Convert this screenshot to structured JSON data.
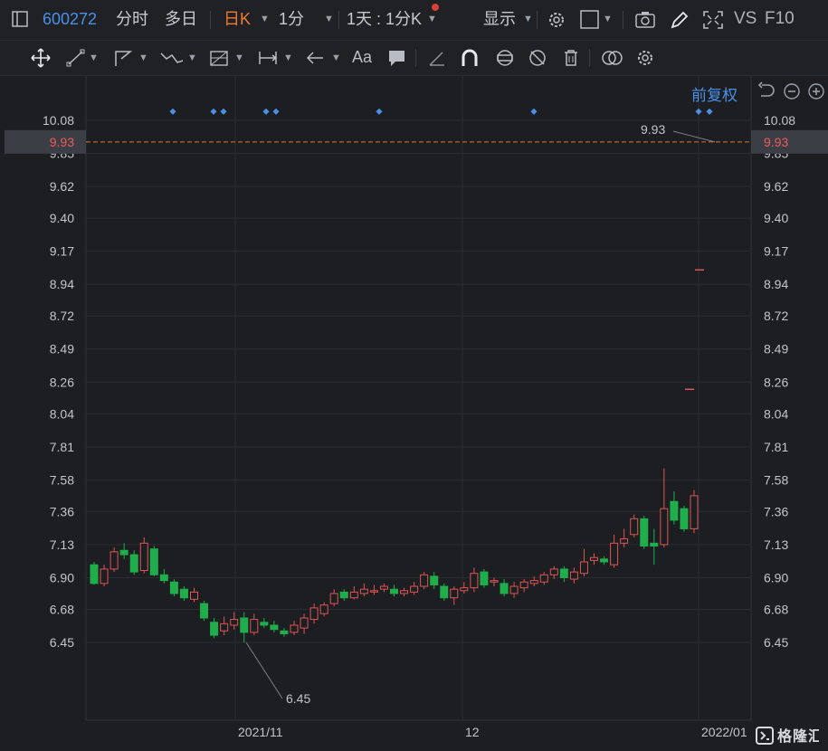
{
  "toolbar": {
    "stock_code": "600272",
    "tab_intraday": "分时",
    "tab_multiday": "多日",
    "tab_daily_k": "日K",
    "period_1min": "1分",
    "range_label": "1天 : 1分K",
    "display_label": "显示",
    "vs_label": "VS",
    "f10_label": "F10"
  },
  "chart_controls": {
    "adjust_label": "前复权"
  },
  "colors": {
    "up": "#e05454",
    "down": "#1fae4b",
    "accent": "#4b8fe8",
    "current_price": "#f05a5a",
    "dashed_line": "#e07030"
  },
  "icons": [
    "layout-icon",
    "chevron-down-icon",
    "gear-icon",
    "square-icon",
    "camera-icon",
    "pencil-icon",
    "fullscreen-icon",
    "move-icon",
    "line-tool-icon",
    "polyline-tool-icon",
    "wave-tool-icon",
    "fib-tool-icon",
    "measure-tool-icon",
    "arrow-tool-icon",
    "text-tool-icon",
    "comment-tool-icon",
    "ruler-icon",
    "magnet-icon",
    "eye-sync-icon",
    "hide-icon",
    "trash-icon",
    "overlap-icon",
    "settings-icon",
    "undo-icon",
    "zoom-out-icon",
    "zoom-in-icon"
  ],
  "chart_data": {
    "type": "candlestick",
    "y_ticks": [
      "10.08",
      "9.85",
      "9.62",
      "9.40",
      "9.17",
      "8.94",
      "8.72",
      "8.49",
      "8.26",
      "8.04",
      "7.81",
      "7.58",
      "7.36",
      "7.13",
      "6.90",
      "6.68",
      "6.45"
    ],
    "x_ticks": [
      "2021/11",
      "12",
      "2022/01"
    ],
    "current_price": "9.93",
    "current_price_annotation": "9.93",
    "low_annotation": "6.45",
    "ylim": [
      6.3,
      10.22
    ],
    "candles": [
      [
        6.99,
        6.86,
        7.01,
        6.85
      ],
      [
        6.86,
        6.96,
        6.99,
        6.84
      ],
      [
        6.96,
        7.08,
        7.11,
        6.94
      ],
      [
        7.09,
        7.06,
        7.14,
        7.03
      ],
      [
        7.06,
        6.94,
        7.09,
        6.92
      ],
      [
        6.95,
        7.14,
        7.18,
        6.93
      ],
      [
        7.1,
        6.92,
        7.12,
        6.91
      ],
      [
        6.92,
        6.88,
        6.96,
        6.86
      ],
      [
        6.87,
        6.79,
        6.89,
        6.77
      ],
      [
        6.82,
        6.76,
        6.84,
        6.74
      ],
      [
        6.75,
        6.8,
        6.83,
        6.73
      ],
      [
        6.72,
        6.62,
        6.74,
        6.6
      ],
      [
        6.59,
        6.5,
        6.62,
        6.48
      ],
      [
        6.53,
        6.58,
        6.63,
        6.5
      ],
      [
        6.57,
        6.61,
        6.66,
        6.54
      ],
      [
        6.62,
        6.52,
        6.66,
        6.45
      ],
      [
        6.52,
        6.61,
        6.65,
        6.5
      ],
      [
        6.59,
        6.57,
        6.62,
        6.55
      ],
      [
        6.57,
        6.54,
        6.6,
        6.52
      ],
      [
        6.53,
        6.51,
        6.55,
        6.49
      ],
      [
        6.52,
        6.57,
        6.6,
        6.5
      ],
      [
        6.55,
        6.62,
        6.65,
        6.51
      ],
      [
        6.61,
        6.69,
        6.72,
        6.58
      ],
      [
        6.65,
        6.71,
        6.73,
        6.63
      ],
      [
        6.72,
        6.79,
        6.82,
        6.7
      ],
      [
        6.8,
        6.76,
        6.82,
        6.74
      ],
      [
        6.76,
        6.8,
        6.84,
        6.75
      ],
      [
        6.79,
        6.82,
        6.86,
        6.77
      ],
      [
        6.81,
        6.81,
        6.85,
        6.78
      ],
      [
        6.82,
        6.84,
        6.86,
        6.8
      ],
      [
        6.82,
        6.79,
        6.85,
        6.77
      ],
      [
        6.79,
        6.81,
        6.83,
        6.77
      ],
      [
        6.8,
        6.84,
        6.87,
        6.78
      ],
      [
        6.84,
        6.92,
        6.94,
        6.82
      ],
      [
        6.91,
        6.85,
        6.94,
        6.82
      ],
      [
        6.84,
        6.76,
        6.86,
        6.74
      ],
      [
        6.76,
        6.82,
        6.84,
        6.71
      ],
      [
        6.81,
        6.83,
        6.87,
        6.79
      ],
      [
        6.83,
        6.93,
        6.97,
        6.8
      ],
      [
        6.94,
        6.85,
        6.96,
        6.83
      ],
      [
        6.87,
        6.88,
        6.9,
        6.84
      ],
      [
        6.86,
        6.79,
        6.89,
        6.77
      ],
      [
        6.79,
        6.84,
        6.87,
        6.76
      ],
      [
        6.83,
        6.87,
        6.89,
        6.8
      ],
      [
        6.86,
        6.88,
        6.91,
        6.84
      ],
      [
        6.87,
        6.92,
        6.94,
        6.85
      ],
      [
        6.92,
        6.96,
        6.98,
        6.89
      ],
      [
        6.96,
        6.9,
        6.98,
        6.87
      ],
      [
        6.89,
        6.94,
        6.97,
        6.86
      ],
      [
        6.93,
        7.01,
        7.1,
        6.91
      ],
      [
        7.02,
        7.04,
        7.07,
        6.99
      ],
      [
        7.03,
        7.01,
        7.05,
        6.99
      ],
      [
        6.99,
        7.14,
        7.2,
        6.97
      ],
      [
        7.14,
        7.17,
        7.24,
        7.11
      ],
      [
        7.2,
        7.31,
        7.34,
        7.18
      ],
      [
        7.31,
        7.12,
        7.33,
        7.1
      ],
      [
        7.14,
        7.12,
        7.24,
        6.99
      ],
      [
        7.13,
        7.38,
        7.66,
        7.11
      ],
      [
        7.43,
        7.3,
        7.5,
        7.27
      ],
      [
        7.38,
        7.24,
        7.4,
        7.22
      ],
      [
        7.24,
        7.47,
        7.51,
        7.21
      ]
    ],
    "markers_after_gap": [
      {
        "price": 9.04,
        "color": "up"
      },
      {
        "price": 8.21,
        "color": "up"
      }
    ]
  }
}
